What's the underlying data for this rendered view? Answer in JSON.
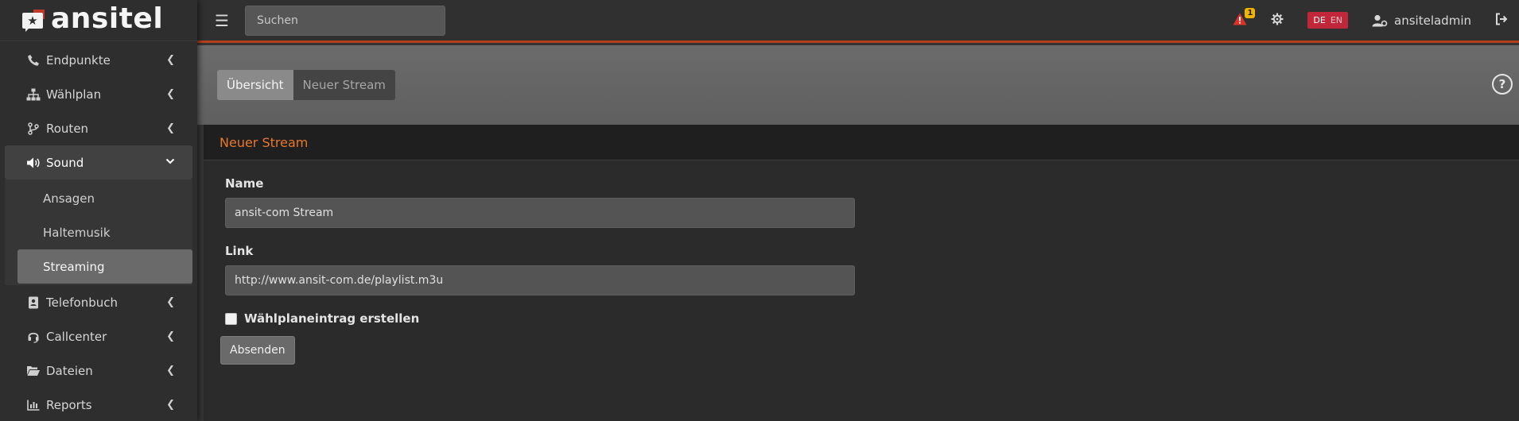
{
  "brand": {
    "name": "ansitel",
    "logo_glyph": "★"
  },
  "topbar": {
    "menu_icon": "hamburger-icon",
    "search_placeholder": "Suchen",
    "alert_count": "1",
    "lang": {
      "de": "DE",
      "en": "EN"
    },
    "user_name": "ansiteladmin"
  },
  "sidebar": {
    "items": [
      {
        "label": "Endpunkte",
        "icon": "phone-icon"
      },
      {
        "label": "Wählplan",
        "icon": "sitemap-icon"
      },
      {
        "label": "Routen",
        "icon": "code-branch-icon"
      },
      {
        "label": "Sound",
        "icon": "volume-icon"
      },
      {
        "label": "Telefonbuch",
        "icon": "address-book-icon"
      },
      {
        "label": "Callcenter",
        "icon": "headset-icon"
      },
      {
        "label": "Dateien",
        "icon": "folder-open-icon"
      },
      {
        "label": "Reports",
        "icon": "chart-bar-icon"
      }
    ],
    "sound_sub": [
      "Ansagen",
      "Haltemusik",
      "Streaming"
    ]
  },
  "tabs": {
    "overview": "Übersicht",
    "new_stream": "Neuer Stream"
  },
  "form": {
    "title": "Neuer Stream",
    "name_label": "Name",
    "name_value": "ansit-com Stream",
    "link_label": "Link",
    "link_value": "http://www.ansit-com.de/playlist.m3u",
    "checkbox_label": "Wählplaneintrag erstellen",
    "submit_label": "Absenden"
  },
  "colors": {
    "accent": "#e8782a",
    "topbar_border": "#b5401c",
    "lang_badge": "#c0283a",
    "alert_badge": "#f0b400"
  }
}
